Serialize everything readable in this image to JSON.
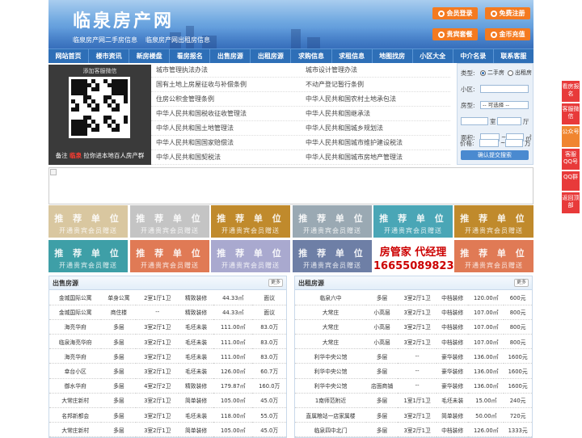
{
  "header": {
    "logo": "临泉房产网",
    "tagline_1": "临泉房产网二手房信息",
    "tagline_2": "临泉房产网出租房信息",
    "buttons": [
      "会员登录",
      "免费注册",
      "贵宾套餐",
      "金币充值"
    ],
    "accent": "#f47a20"
  },
  "nav": [
    "网站首页",
    "楼市资讯",
    "新房楼盘",
    "看房报名",
    "出售房源",
    "出租房源",
    "求购信息",
    "求租信息",
    "地图找房",
    "小区大全",
    "中介名录",
    "联系客服"
  ],
  "qr": {
    "title": "添加客服微信",
    "caption_pre": "备注",
    "caption_red": "临泉",
    "caption_post": "拉你进本地百人房产群"
  },
  "links": [
    [
      "城市管理执法办法",
      "城市设计管理办法"
    ],
    [
      "国有土地上房屋征收与补偿条例",
      "不动产登记暂行条例"
    ],
    [
      "住房公积金管理条例",
      "中华人民共和国农村土地承包法"
    ],
    [
      "中华人民共和国税收征收管理法",
      "中华人民共和国继承法"
    ],
    [
      "中华人民共和国土地管理法",
      "中华人民共和国城乡规划法"
    ],
    [
      "中华人民共和国国家赔偿法",
      "中华人民共和国城市维护建设税法"
    ],
    [
      "中华人民共和国契税法",
      "中华人民共和国城市房地产管理法"
    ]
  ],
  "search": {
    "type_label": "类型:",
    "opt_sale": "二手房",
    "opt_rent": "出租房",
    "community_label": "小区:",
    "layout_label": "房型:",
    "layout_select": "-- 可选择 --",
    "room_label": "室",
    "hall_label": "厅",
    "area_label": "面积:",
    "area_unit": "㎡",
    "price_label": "价格:",
    "price_unit": "万",
    "dash": "~",
    "submit": "确认提交搜索"
  },
  "ads": {
    "t1": "推 荐 单 位",
    "t2": "开通贵宾会员赠送",
    "colors": [
      "#d9c7a0",
      "#c4c4c4",
      "#c08a2c",
      "#9aa9b3",
      "#4aa6b6",
      "#c08a2c",
      "#3e9fa7",
      "#e07a55",
      "#a9a9cf",
      "#6e7fa6",
      "#ffffff",
      "#e07a55"
    ],
    "special_name": "房管家 代经理",
    "special_phone": "16655089823"
  },
  "sale": {
    "title": "出售房源",
    "more": "更多",
    "rows": [
      [
        "金城国际公寓",
        "单身公寓",
        "2室1厅1卫",
        "精致装修",
        "44.33㎡",
        "面议"
      ],
      [
        "金城国际公寓",
        "商住楼",
        "--",
        "精致装修",
        "44.33㎡",
        "面议"
      ],
      [
        "海亮华府",
        "多层",
        "3室2厅1卫",
        "毛坯未装",
        "111.00㎡",
        "83.0万"
      ],
      [
        "临泉海亮华府",
        "多层",
        "3室2厅1卫",
        "毛坯未装",
        "111.00㎡",
        "83.0万"
      ],
      [
        "海亮华府",
        "多层",
        "3室2厅1卫",
        "毛坯未装",
        "111.00㎡",
        "83.0万"
      ],
      [
        "幸台小区",
        "多层",
        "3室2厅1卫",
        "毛坯未装",
        "126.00㎡",
        "60.7万"
      ],
      [
        "御水华府",
        "多层",
        "4室2厅2卫",
        "精致装修",
        "179.87㎡",
        "160.0万"
      ],
      [
        "大常庄新村",
        "多层",
        "3室2厅1卫",
        "简单装修",
        "105.00㎡",
        "45.0万"
      ],
      [
        "名邦新都会",
        "多层",
        "3室2厅1卫",
        "毛坯未装",
        "118.00㎡",
        "55.0万"
      ],
      [
        "大常庄新村",
        "多层",
        "3室2厅1卫",
        "简单装修",
        "105.00㎡",
        "45.0万"
      ]
    ]
  },
  "rent": {
    "title": "出租房源",
    "more": "更多",
    "rows": [
      [
        "临泉六中",
        "多层",
        "3室2厅1卫",
        "中档装修",
        "120.00㎡",
        "600元"
      ],
      [
        "大常庄",
        "小高层",
        "3室2厅1卫",
        "中档装修",
        "107.00㎡",
        "800元"
      ],
      [
        "大常庄",
        "小高层",
        "3室2厅1卫",
        "中档装修",
        "107.00㎡",
        "800元"
      ],
      [
        "大常庄",
        "小高层",
        "3室2厅1卫",
        "中档装修",
        "107.00㎡",
        "800元"
      ],
      [
        "利华中央公馆",
        "多层",
        "--",
        "豪华装修",
        "136.00㎡",
        "1600元"
      ],
      [
        "利华中央公馆",
        "多层",
        "--",
        "豪华装修",
        "136.00㎡",
        "1600元"
      ],
      [
        "利华中央公馆",
        "店面商铺",
        "--",
        "豪华装修",
        "136.00㎡",
        "1600元"
      ],
      [
        "1南师范附近",
        "多层",
        "1室1厅1卫",
        "毛坯未装",
        "15.00㎡",
        "240元"
      ],
      [
        "直属粮站一店家属楼",
        "多层",
        "3室2厅1卫",
        "简单装修",
        "50.00㎡",
        "720元"
      ],
      [
        "临泉四中北门",
        "多层",
        "3室2厅1卫",
        "中档装修",
        "126.00㎡",
        "1333元"
      ]
    ]
  },
  "side": [
    "看房报名",
    "客服微信",
    "公众号",
    "客服QQ号",
    "QQ群",
    "返回顶部"
  ]
}
